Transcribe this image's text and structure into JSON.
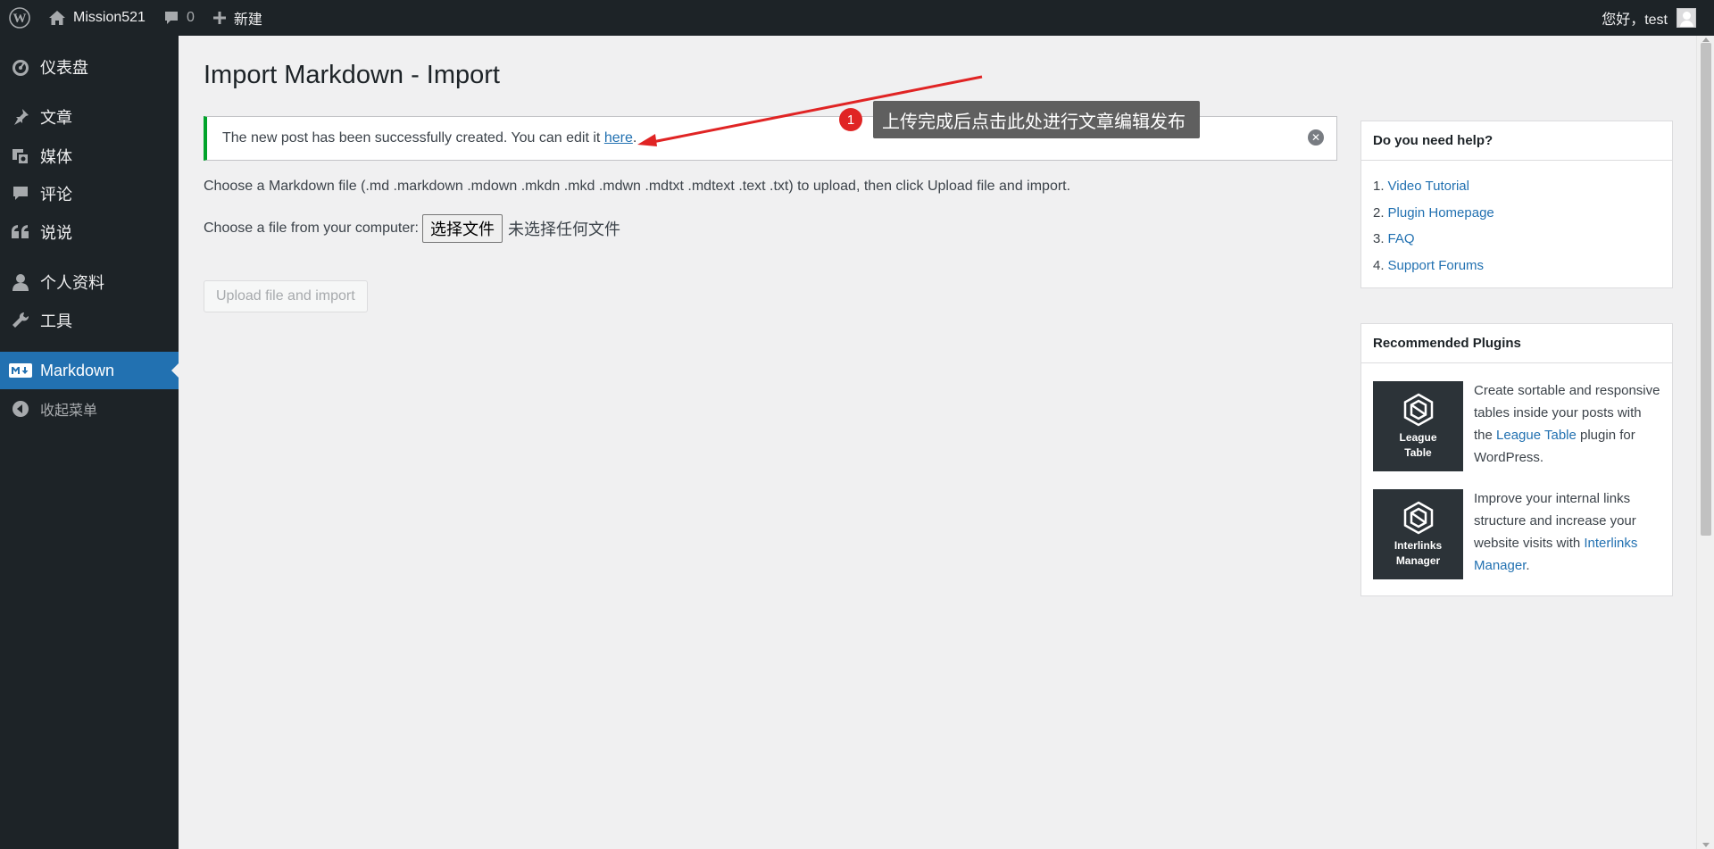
{
  "adminbar": {
    "site_name": "Mission521",
    "comment_count": "0",
    "new_label": "新建",
    "greeting": "您好，test"
  },
  "sidebar": {
    "items": [
      {
        "label": "仪表盘",
        "icon": "dashboard-icon"
      },
      {
        "label": "文章",
        "icon": "pushpin-icon"
      },
      {
        "label": "媒体",
        "icon": "media-icon"
      },
      {
        "label": "评论",
        "icon": "comment-icon"
      },
      {
        "label": "说说",
        "icon": "quote-icon"
      },
      {
        "label": "个人资料",
        "icon": "user-icon"
      },
      {
        "label": "工具",
        "icon": "wrench-icon"
      },
      {
        "label": "Markdown",
        "icon": "markdown-icon"
      },
      {
        "label": "收起菜单",
        "icon": "collapse-icon"
      }
    ],
    "active": "Markdown"
  },
  "main": {
    "title": "Import Markdown - Import",
    "notice": {
      "text": "The new post has been successfully created. You can edit it ",
      "link": "here",
      "suffix": "."
    },
    "description": "Choose a Markdown file (.md .markdown .mdown .mkdn .mkd .mdwn .mdtxt .mdtext .text .txt) to upload, then click Upload file and import.",
    "file_label": "Choose a file from your computer:",
    "file_button": "选择文件",
    "file_none": "未选择任何文件",
    "upload_button": "Upload file and import"
  },
  "annotation": {
    "badge": "1",
    "text": "上传完成后点击此处进行文章编辑发布",
    "color": "#e02424"
  },
  "help": {
    "title": "Do you need help?",
    "items": [
      {
        "num": "1.",
        "label": "Video Tutorial"
      },
      {
        "num": "2.",
        "label": "Plugin Homepage"
      },
      {
        "num": "3.",
        "label": "FAQ"
      },
      {
        "num": "4.",
        "label": "Support Forums"
      }
    ]
  },
  "recommended": {
    "title": "Recommended Plugins",
    "plugins": [
      {
        "logo_line1": "League",
        "logo_line2": "Table",
        "text_before": "Create sortable and responsive tables inside your posts with the ",
        "link": "League Table",
        "text_after": " plugin for WordPress."
      },
      {
        "logo_line1": "Interlinks",
        "logo_line2": "Manager",
        "text_before": "Improve your internal links structure and increase your website visits with ",
        "link": "Interlinks Manager",
        "text_after": "."
      }
    ]
  },
  "colors": {
    "admin_dark": "#1d2327",
    "accent": "#2271b1",
    "success": "#00a32a"
  }
}
